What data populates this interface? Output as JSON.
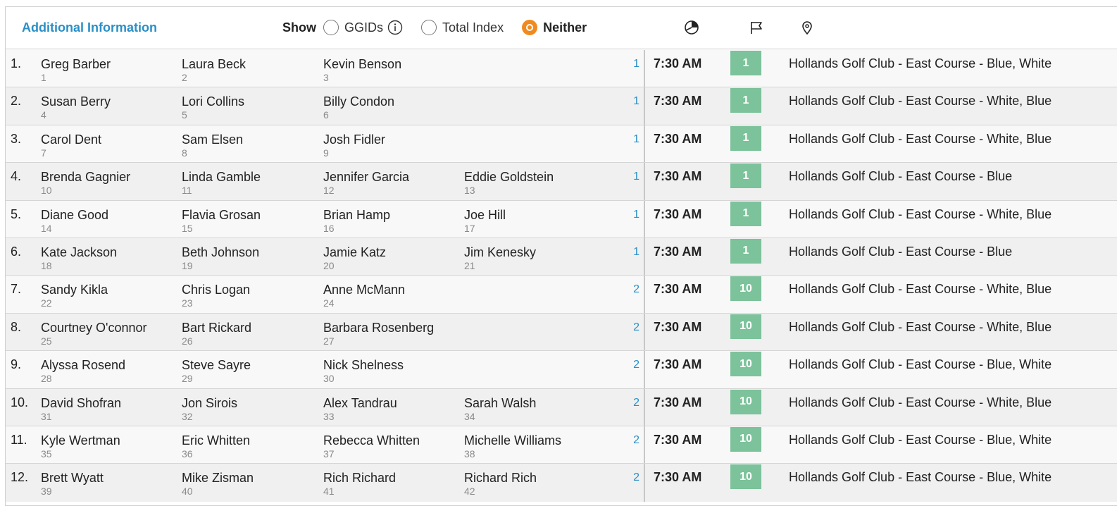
{
  "header": {
    "title": "Additional Information",
    "show_label": "Show",
    "options": [
      {
        "label": "GGIDs",
        "checked": false,
        "info_icon": "info-icon"
      },
      {
        "label": "Total Index",
        "checked": false
      },
      {
        "label": "Neither",
        "checked": true
      }
    ],
    "column_icons": [
      "pie-chart-icon",
      "flag-icon",
      "map-pin-icon"
    ]
  },
  "colors": {
    "accent": "#2a8fc7",
    "selected_radio": "#f08a20",
    "hole_badge": "#7cc29a"
  },
  "groups": [
    {
      "num": "1.",
      "players": [
        {
          "name": "Greg Barber",
          "id": "1"
        },
        {
          "name": "Laura Beck",
          "id": "2"
        },
        {
          "name": "Kevin Benson",
          "id": "3"
        }
      ],
      "round": "1",
      "time": "7:30 AM",
      "hole": "1",
      "course": "Hollands Golf Club - East Course - Blue, White"
    },
    {
      "num": "2.",
      "players": [
        {
          "name": "Susan Berry",
          "id": "4"
        },
        {
          "name": "Lori Collins",
          "id": "5"
        },
        {
          "name": "Billy Condon",
          "id": "6"
        }
      ],
      "round": "1",
      "time": "7:30 AM",
      "hole": "1",
      "course": "Hollands Golf Club - East Course - White, Blue"
    },
    {
      "num": "3.",
      "players": [
        {
          "name": "Carol Dent",
          "id": "7"
        },
        {
          "name": "Sam Elsen",
          "id": "8"
        },
        {
          "name": "Josh Fidler",
          "id": "9"
        }
      ],
      "round": "1",
      "time": "7:30 AM",
      "hole": "1",
      "course": "Hollands Golf Club - East Course - White, Blue"
    },
    {
      "num": "4.",
      "players": [
        {
          "name": "Brenda Gagnier",
          "id": "10"
        },
        {
          "name": "Linda Gamble",
          "id": "11"
        },
        {
          "name": "Jennifer Garcia",
          "id": "12"
        },
        {
          "name": "Eddie Goldstein",
          "id": "13"
        }
      ],
      "round": "1",
      "time": "7:30 AM",
      "hole": "1",
      "course": "Hollands Golf Club - East Course - Blue"
    },
    {
      "num": "5.",
      "players": [
        {
          "name": "Diane Good",
          "id": "14"
        },
        {
          "name": "Flavia Grosan",
          "id": "15"
        },
        {
          "name": "Brian Hamp",
          "id": "16"
        },
        {
          "name": "Joe Hill",
          "id": "17"
        }
      ],
      "round": "1",
      "time": "7:30 AM",
      "hole": "1",
      "course": "Hollands Golf Club - East Course - White, Blue"
    },
    {
      "num": "6.",
      "players": [
        {
          "name": "Kate Jackson",
          "id": "18"
        },
        {
          "name": "Beth Johnson",
          "id": "19"
        },
        {
          "name": "Jamie Katz",
          "id": "20"
        },
        {
          "name": "Jim Kenesky",
          "id": "21"
        }
      ],
      "round": "1",
      "time": "7:30 AM",
      "hole": "1",
      "course": "Hollands Golf Club - East Course - Blue"
    },
    {
      "num": "7.",
      "players": [
        {
          "name": "Sandy Kikla",
          "id": "22"
        },
        {
          "name": "Chris Logan",
          "id": "23"
        },
        {
          "name": "Anne McMann",
          "id": "24"
        }
      ],
      "round": "2",
      "time": "7:30 AM",
      "hole": "10",
      "course": "Hollands Golf Club - East Course - White, Blue"
    },
    {
      "num": "8.",
      "players": [
        {
          "name": "Courtney O'connor",
          "id": "25"
        },
        {
          "name": "Bart Rickard",
          "id": "26"
        },
        {
          "name": "Barbara Rosenberg",
          "id": "27"
        }
      ],
      "round": "2",
      "time": "7:30 AM",
      "hole": "10",
      "course": "Hollands Golf Club - East Course - White, Blue"
    },
    {
      "num": "9.",
      "players": [
        {
          "name": "Alyssa Rosend",
          "id": "28"
        },
        {
          "name": "Steve Sayre",
          "id": "29"
        },
        {
          "name": "Nick Shelness",
          "id": "30"
        }
      ],
      "round": "2",
      "time": "7:30 AM",
      "hole": "10",
      "course": "Hollands Golf Club - East Course - Blue, White"
    },
    {
      "num": "10.",
      "players": [
        {
          "name": "David Shofran",
          "id": "31"
        },
        {
          "name": "Jon Sirois",
          "id": "32"
        },
        {
          "name": "Alex Tandrau",
          "id": "33"
        },
        {
          "name": "Sarah Walsh",
          "id": "34"
        }
      ],
      "round": "2",
      "time": "7:30 AM",
      "hole": "10",
      "course": "Hollands Golf Club - East Course - White, Blue"
    },
    {
      "num": "11.",
      "players": [
        {
          "name": "Kyle Wertman",
          "id": "35"
        },
        {
          "name": "Eric Whitten",
          "id": "36"
        },
        {
          "name": "Rebecca Whitten",
          "id": "37"
        },
        {
          "name": "Michelle Williams",
          "id": "38"
        }
      ],
      "round": "2",
      "time": "7:30 AM",
      "hole": "10",
      "course": "Hollands Golf Club - East Course - Blue, White"
    },
    {
      "num": "12.",
      "players": [
        {
          "name": "Brett Wyatt",
          "id": "39"
        },
        {
          "name": "Mike Zisman",
          "id": "40"
        },
        {
          "name": "Rich Richard",
          "id": "41"
        },
        {
          "name": "Richard Rich",
          "id": "42"
        }
      ],
      "round": "2",
      "time": "7:30 AM",
      "hole": "10",
      "course": "Hollands Golf Club - East Course - Blue, White"
    }
  ]
}
